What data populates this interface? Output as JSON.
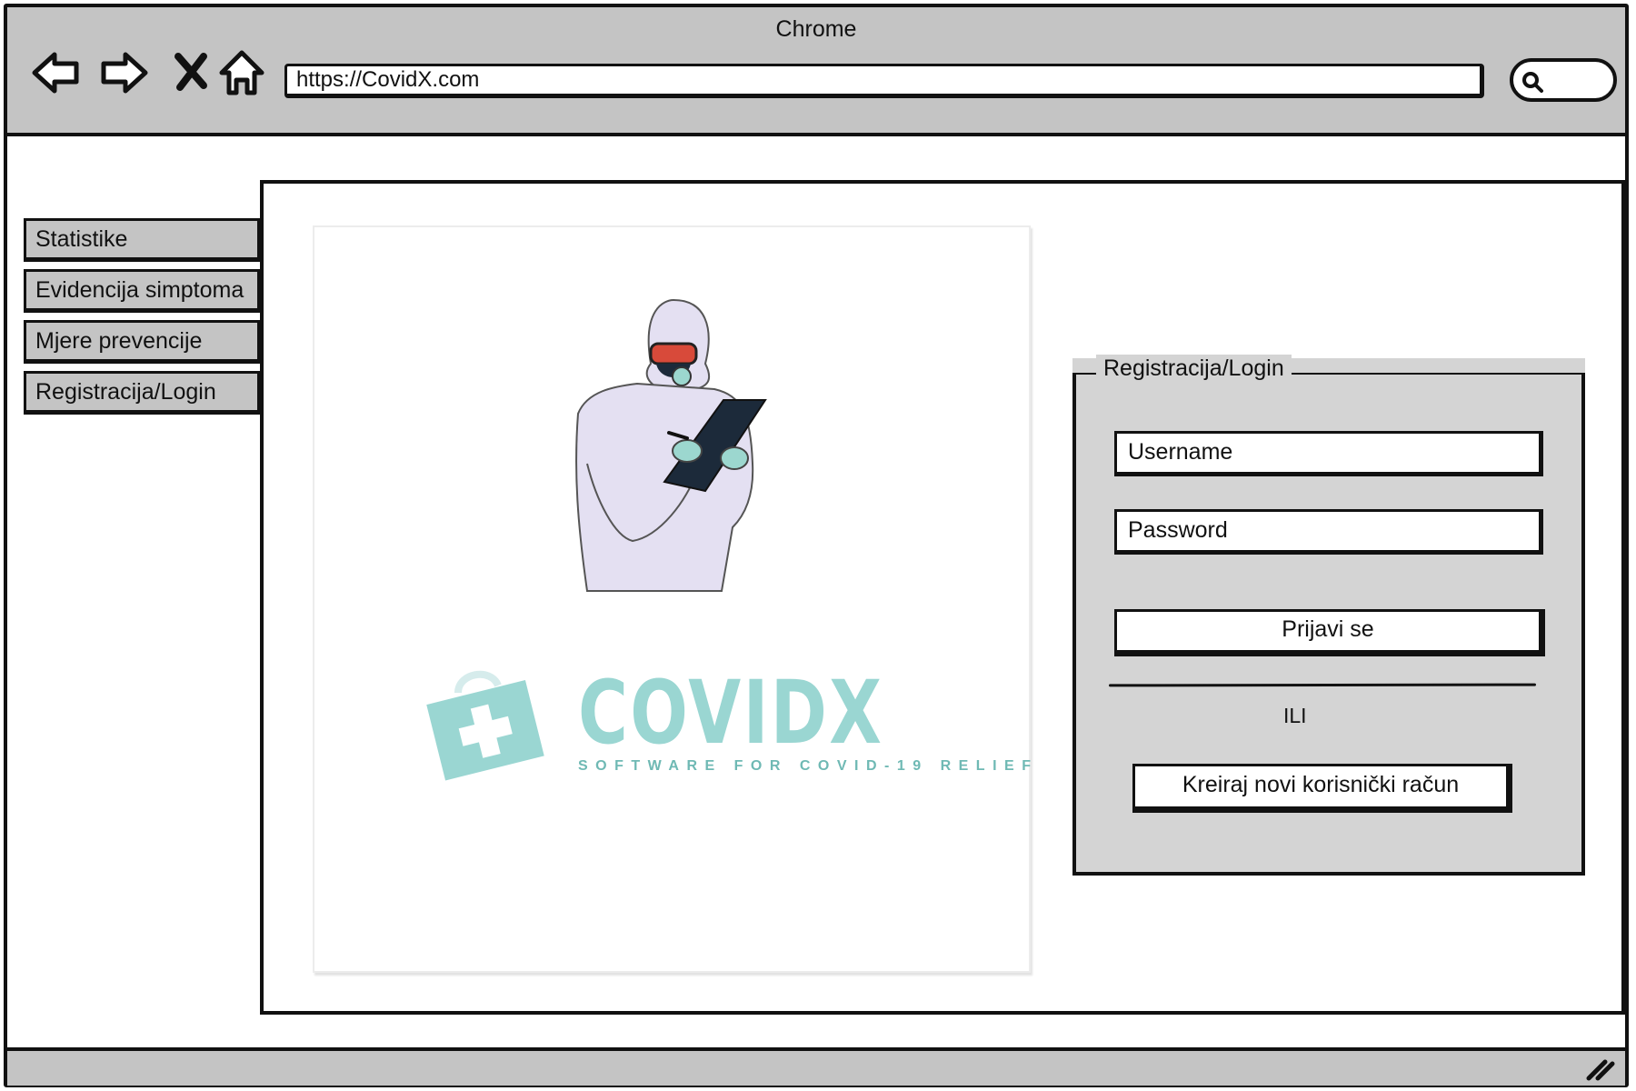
{
  "browser": {
    "title": "Chrome",
    "url": "https://CovidX.com"
  },
  "sidebar": {
    "items": [
      {
        "label": "Statistike"
      },
      {
        "label": "Evidencija simptoma"
      },
      {
        "label": "Mjere prevencije"
      },
      {
        "label": "Registracija/Login"
      }
    ]
  },
  "hero": {
    "brand": "COVIDX",
    "tagline": "SOFTWARE FOR COVID-19 RELIEF"
  },
  "login": {
    "legend": "Registracija/Login",
    "username_placeholder": "Username",
    "password_placeholder": "Password",
    "login_button": "Prijavi se",
    "separator": "ILI",
    "register_button": "Kreiraj novi korisnički račun"
  },
  "colors": {
    "chrome_gray": "#c4c4c4",
    "panel_gray": "#d4d4d4",
    "brand_teal": "#9ad6d2"
  }
}
